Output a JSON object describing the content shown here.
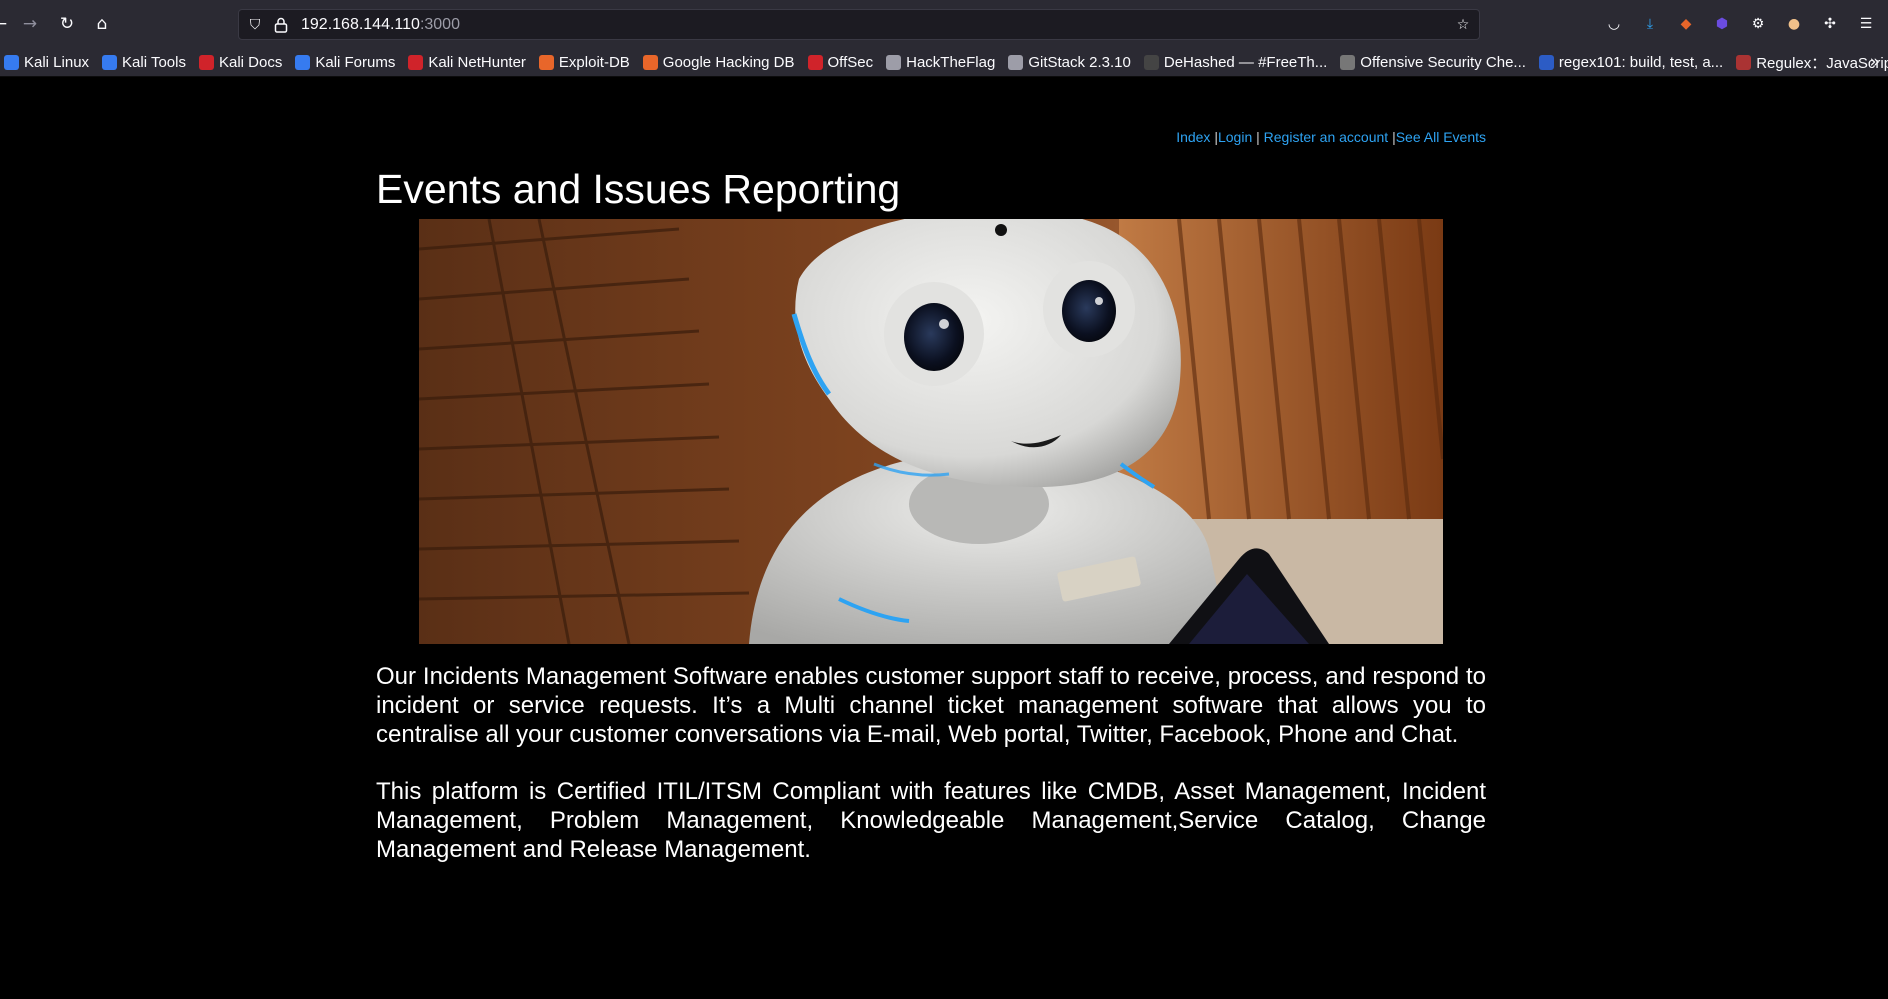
{
  "browser": {
    "url_host": "192.168.144.110",
    "url_port": ":3000",
    "bookmarks": [
      {
        "label": "Kali Linux",
        "icon": "kali-dragon-icon",
        "color": "#367bf0"
      },
      {
        "label": "Kali Tools",
        "icon": "kali-tools-icon",
        "color": "#367bf0"
      },
      {
        "label": "Kali Docs",
        "icon": "kali-docs-icon",
        "color": "#d0232a"
      },
      {
        "label": "Kali Forums",
        "icon": "kali-forums-icon",
        "color": "#367bf0"
      },
      {
        "label": "Kali NetHunter",
        "icon": "nethunter-icon",
        "color": "#d0232a"
      },
      {
        "label": "Exploit-DB",
        "icon": "exploit-db-icon",
        "color": "#e8662a"
      },
      {
        "label": "Google Hacking DB",
        "icon": "ghdb-icon",
        "color": "#e8662a"
      },
      {
        "label": "OffSec",
        "icon": "offsec-icon",
        "color": "#d0232a"
      },
      {
        "label": "HackTheFlag",
        "icon": "flag-icon",
        "color": "#9d9da8"
      },
      {
        "label": "GitStack 2.3.10",
        "icon": "globe-icon",
        "color": "#9d9da8"
      },
      {
        "label": "DeHashed — #FreeTh...",
        "icon": "hash-icon",
        "color": "#444"
      },
      {
        "label": "Offensive Security Che...",
        "icon": "offsec-cheatsheet-icon",
        "color": "#777"
      },
      {
        "label": "regex101: build, test, a...",
        "icon": "regex101-icon",
        "color": "#2c5cc5"
      },
      {
        "label": "Regulex：JavaScript R...",
        "icon": "regulex-icon",
        "color": "#a33"
      }
    ]
  },
  "nav": {
    "index": "Index",
    "sep1": " |",
    "login": "Login",
    "sep2": " | ",
    "register": "Register an account",
    "sep3": " |",
    "events": "See All Events"
  },
  "page": {
    "title": "Events and Issues Reporting",
    "paragraph1": "Our Incidents Management Software enables customer support staff to receive, process, and respond to incident or service requests. It’s a Multi channel ticket management software that allows you to centralise all your customer conversations via E-mail, Web portal, Twitter, Facebook, Phone and Chat.",
    "paragraph2": "This platform is Certified ITIL/ITSM Compliant with features like CMDB, Asset Management, Incident Management, Problem Management, Knowledgeable Management,Service Catalog, Change Management and Release Management."
  }
}
